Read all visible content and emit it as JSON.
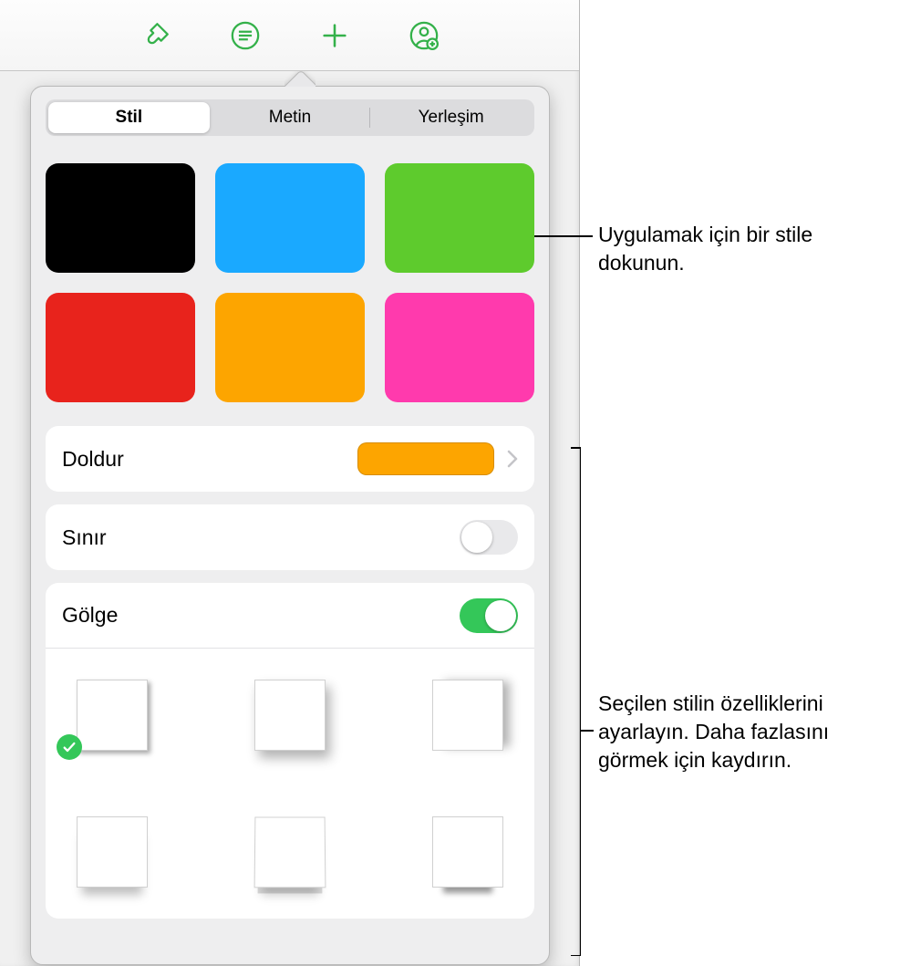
{
  "toolbar": {
    "icons": [
      "brush-icon",
      "list-icon",
      "add-icon",
      "collaborate-icon"
    ]
  },
  "segmented": {
    "items": [
      "Stil",
      "Metin",
      "Yerleşim"
    ],
    "active_index": 0
  },
  "style_swatches": [
    {
      "name": "black",
      "color": "#000000"
    },
    {
      "name": "blue",
      "color": "#1aa9ff"
    },
    {
      "name": "green",
      "color": "#5ecb2d"
    },
    {
      "name": "red",
      "color": "#e8231c"
    },
    {
      "name": "orange",
      "color": "#fda500"
    },
    {
      "name": "magenta",
      "color": "#ff3aad"
    }
  ],
  "rows": {
    "fill": {
      "label": "Doldur",
      "swatch_color": "#fda500"
    },
    "border": {
      "label": "Sınır",
      "on": false
    },
    "shadow": {
      "label": "Gölge",
      "on": true
    }
  },
  "shadow_options": [
    {
      "name": "drop-small",
      "selected": true
    },
    {
      "name": "drop-soft",
      "selected": false
    },
    {
      "name": "side-right",
      "selected": false
    },
    {
      "name": "contact-below",
      "selected": false
    },
    {
      "name": "curved-page",
      "selected": false
    },
    {
      "name": "flat-under",
      "selected": false
    }
  ],
  "callouts": {
    "top": "Uygulamak için bir stile dokunun.",
    "bottom": "Seçilen stilin özelliklerini ayarlayın. Daha fazlasını görmek için kaydırın."
  },
  "colors": {
    "accent": "#34c759",
    "toolbar_icon": "#34b14a"
  }
}
